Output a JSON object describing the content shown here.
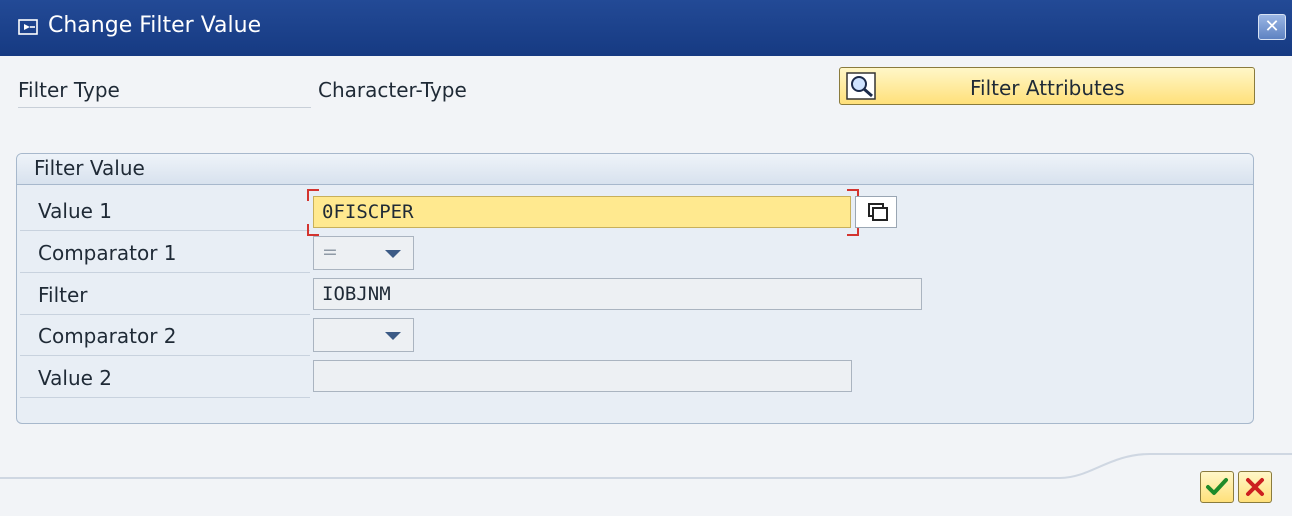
{
  "window": {
    "title": "Change Filter Value",
    "close_icon": "close-icon"
  },
  "header": {
    "filter_type_label": "Filter Type",
    "filter_type_value": "Character-Type",
    "filter_attributes_button": "Filter Attributes"
  },
  "group": {
    "title": "Filter Value",
    "rows": [
      {
        "label": "Value 1",
        "value": "0FISCPER"
      },
      {
        "label": "Comparator 1",
        "value": "="
      },
      {
        "label": "Filter",
        "value": "IOBJNM"
      },
      {
        "label": "Comparator 2",
        "value": ""
      },
      {
        "label": "Value 2",
        "value": ""
      }
    ]
  },
  "footer": {
    "ok_icon": "checkmark-icon",
    "cancel_icon": "cancel-x-icon"
  },
  "colors": {
    "title_bar": "#234a96",
    "focus_field": "#ffe98f",
    "button_yellow": "#ffe07a"
  }
}
